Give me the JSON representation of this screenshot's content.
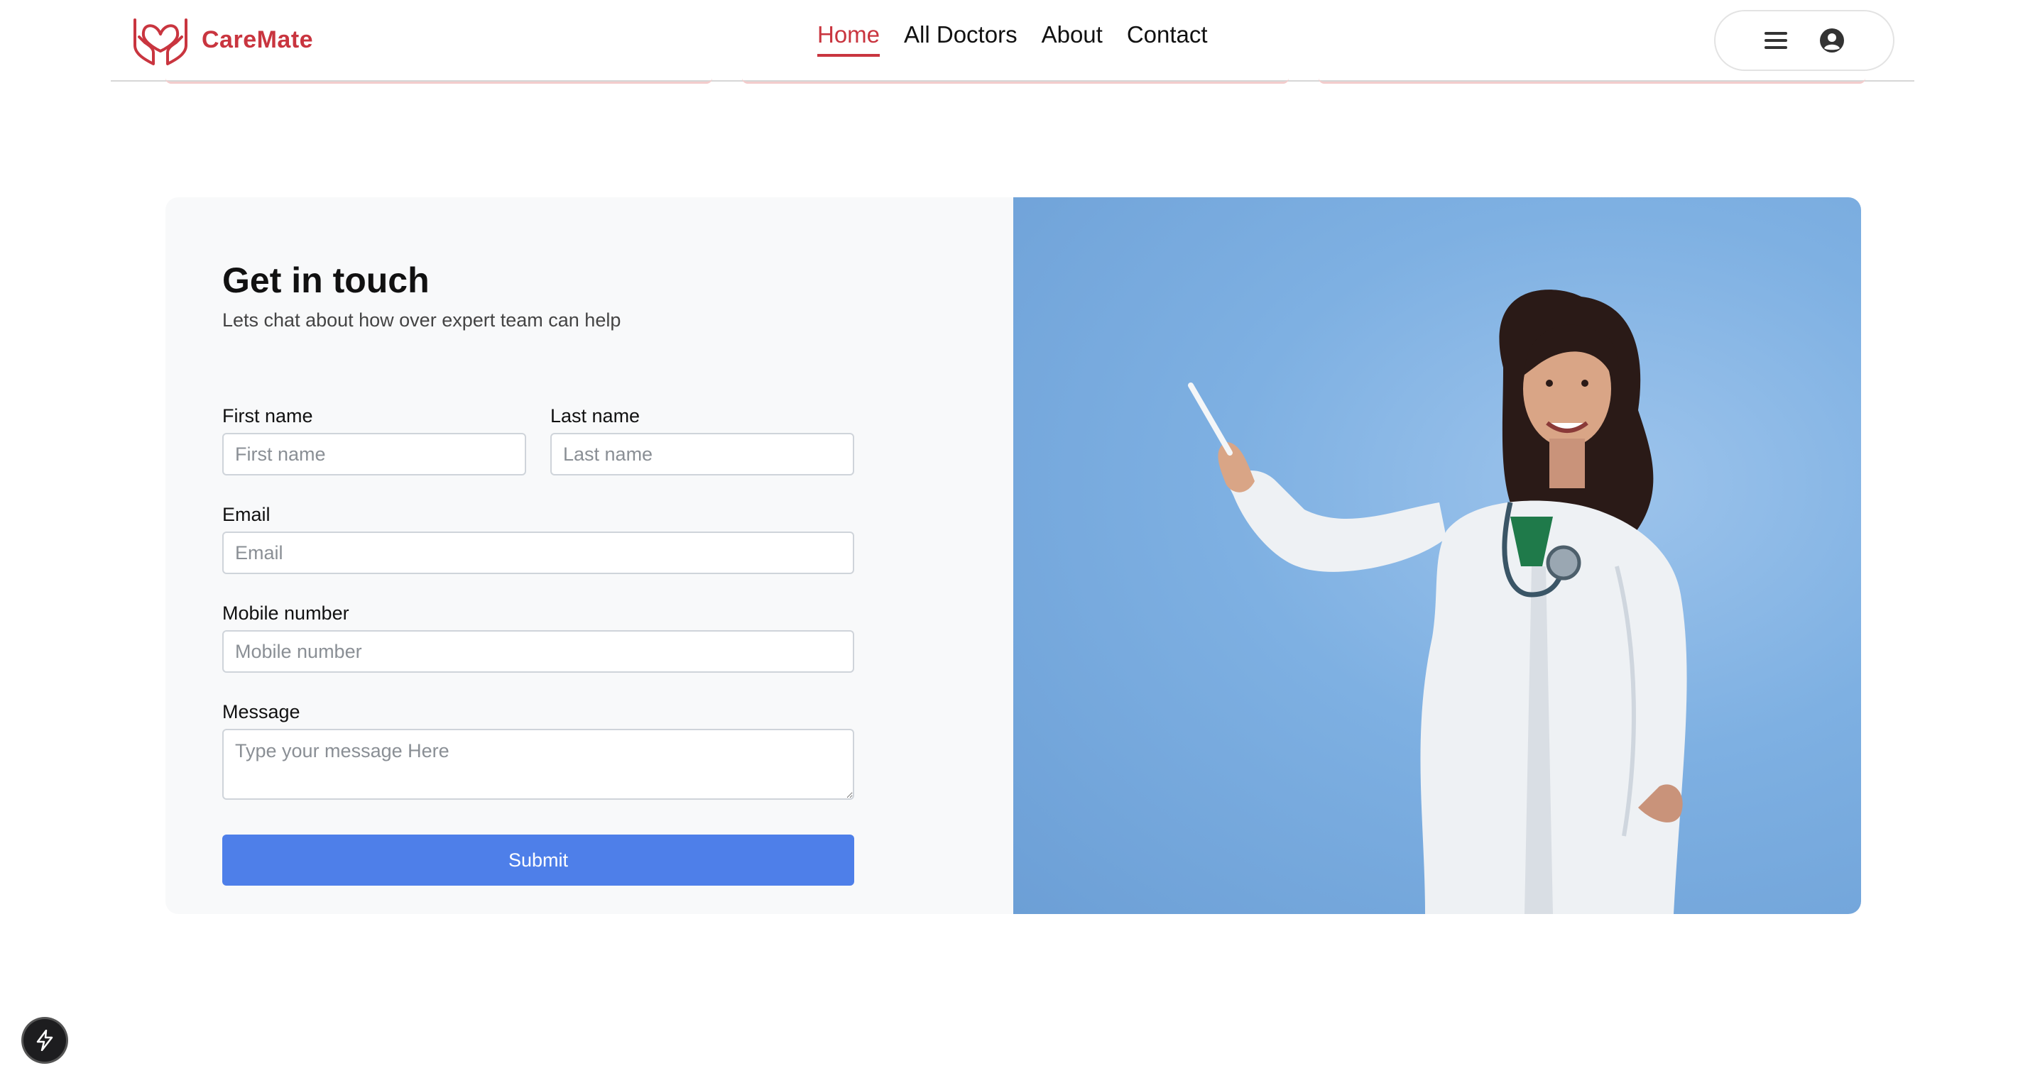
{
  "brand": {
    "name": "CareMate",
    "logo_icon": "heart-hands-icon",
    "color": "#c9353f"
  },
  "nav": {
    "items": [
      {
        "label": "Home",
        "active": true
      },
      {
        "label": "All Doctors",
        "active": false
      },
      {
        "label": "About",
        "active": false
      },
      {
        "label": "Contact",
        "active": false
      }
    ]
  },
  "user_menu": {
    "menu_icon": "hamburger-icon",
    "profile_icon": "user-circle-icon"
  },
  "contact": {
    "title": "Get in touch",
    "subtitle": "Lets chat about how over expert team can help",
    "fields": {
      "first_name": {
        "label": "First name",
        "placeholder": "First name",
        "value": ""
      },
      "last_name": {
        "label": "Last name",
        "placeholder": "Last name",
        "value": ""
      },
      "email": {
        "label": "Email",
        "placeholder": "Email",
        "value": ""
      },
      "mobile": {
        "label": "Mobile number",
        "placeholder": "Mobile number",
        "value": ""
      },
      "message": {
        "label": "Message",
        "placeholder": "Type your message Here",
        "value": ""
      }
    },
    "submit_label": "Submit",
    "submit_color": "#4e7fe9",
    "image_description_icon": "doctor-photo"
  },
  "floating_button": {
    "icon": "bolt-icon"
  }
}
